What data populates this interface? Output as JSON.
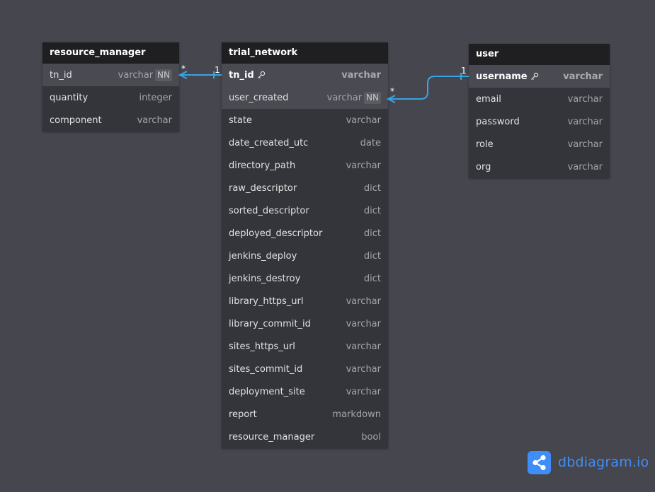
{
  "tables": {
    "resource_manager": {
      "name": "resource_manager",
      "fields": [
        {
          "name": "tn_id",
          "type": "varchar",
          "badge": "NN"
        },
        {
          "name": "quantity",
          "type": "integer"
        },
        {
          "name": "component",
          "type": "varchar"
        }
      ]
    },
    "trial_network": {
      "name": "trial_network",
      "fields": [
        {
          "name": "tn_id",
          "type": "varchar",
          "pk": true
        },
        {
          "name": "user_created",
          "type": "varchar",
          "badge": "NN"
        },
        {
          "name": "state",
          "type": "varchar"
        },
        {
          "name": "date_created_utc",
          "type": "date"
        },
        {
          "name": "directory_path",
          "type": "varchar"
        },
        {
          "name": "raw_descriptor",
          "type": "dict"
        },
        {
          "name": "sorted_descriptor",
          "type": "dict"
        },
        {
          "name": "deployed_descriptor",
          "type": "dict"
        },
        {
          "name": "jenkins_deploy",
          "type": "dict"
        },
        {
          "name": "jenkins_destroy",
          "type": "dict"
        },
        {
          "name": "library_https_url",
          "type": "varchar"
        },
        {
          "name": "library_commit_id",
          "type": "varchar"
        },
        {
          "name": "sites_https_url",
          "type": "varchar"
        },
        {
          "name": "sites_commit_id",
          "type": "varchar"
        },
        {
          "name": "deployment_site",
          "type": "varchar"
        },
        {
          "name": "report",
          "type": "markdown"
        },
        {
          "name": "resource_manager",
          "type": "bool"
        }
      ]
    },
    "user": {
      "name": "user",
      "fields": [
        {
          "name": "username",
          "type": "varchar",
          "pk": true
        },
        {
          "name": "email",
          "type": "varchar"
        },
        {
          "name": "password",
          "type": "varchar"
        },
        {
          "name": "role",
          "type": "varchar"
        },
        {
          "name": "org",
          "type": "varchar"
        }
      ]
    }
  },
  "relations": [
    {
      "from": "resource_manager.tn_id",
      "to": "trial_network.tn_id",
      "from_card": "*",
      "to_card": "1"
    },
    {
      "from": "trial_network.user_created",
      "to": "user.username",
      "from_card": "*",
      "to_card": "1"
    }
  ],
  "colors": {
    "background": "#46464f",
    "table_body": "#34343b",
    "table_header": "#1f1f21",
    "relation_line": "#3aa3e3",
    "brand": "#3f8ef7"
  },
  "brand": {
    "name": "dbdiagram",
    "suffix": ".io",
    "icon": "share-icon"
  }
}
